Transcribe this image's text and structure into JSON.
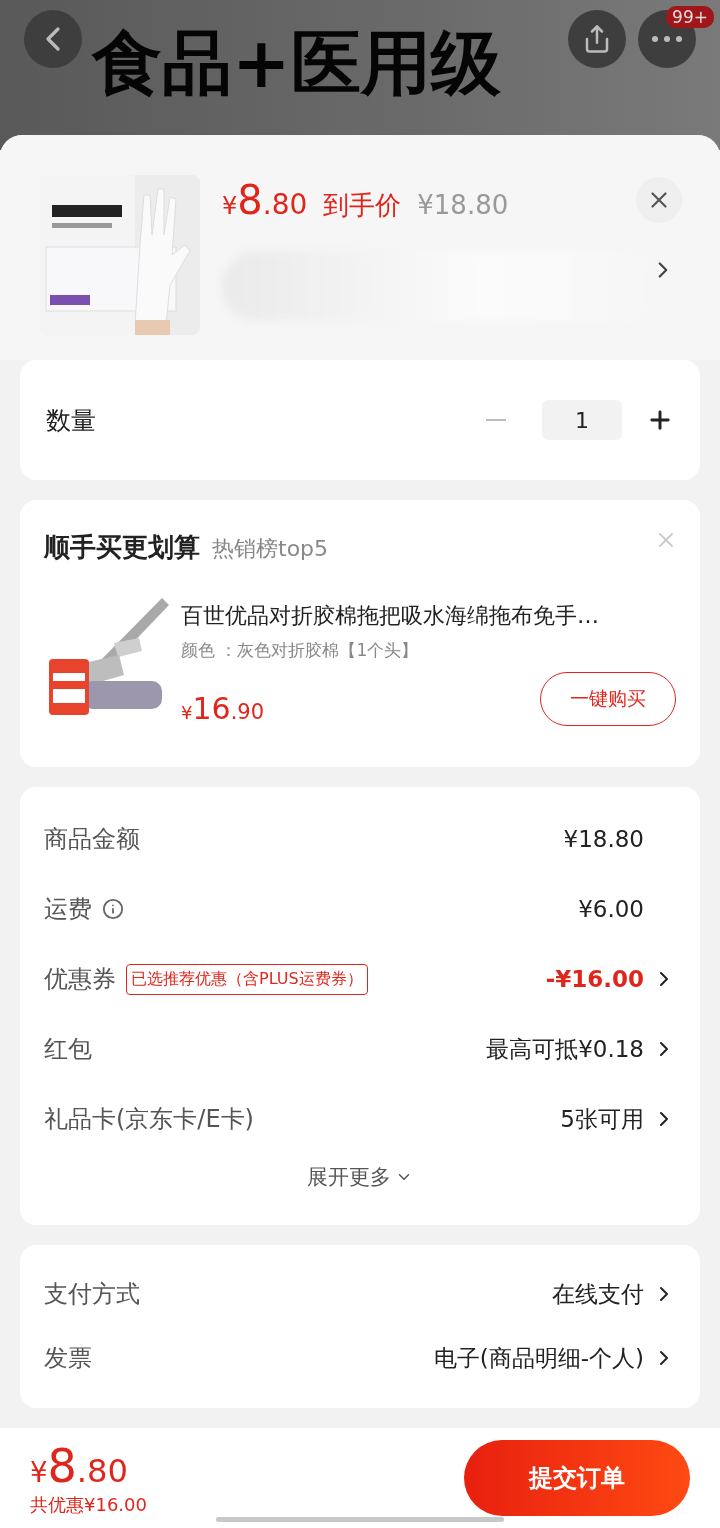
{
  "hero": {
    "title": "食品+医用级",
    "badge": "99+"
  },
  "header": {
    "price": {
      "currency": "¥",
      "integer": "8",
      "decimal": ".80"
    },
    "price_label": "到手价",
    "original_price": "¥18.80"
  },
  "quantity": {
    "label": "数量",
    "value": "1"
  },
  "recommend": {
    "title": "顺手买更划算",
    "subtitle": "热销榜top5",
    "item": {
      "name": "百世优品对折胶棉拖把吸水海绵拖布免手…",
      "spec": "颜色 ：灰色对折胶棉【1个头】",
      "price": {
        "currency": "¥",
        "integer": "16",
        "decimal": ".90"
      },
      "button": "一键购买"
    }
  },
  "summary": {
    "rows": [
      {
        "kind": "plain",
        "label": "商品金额",
        "value": "¥18.80",
        "info": false,
        "chevron": false
      },
      {
        "kind": "plain",
        "label": "运费",
        "value": "¥6.00",
        "info": true,
        "chevron": false
      },
      {
        "kind": "coupon",
        "label": "优惠券",
        "tag": "已选推荐优惠（含PLUS运费券）",
        "value": "-¥16.00",
        "info": false,
        "chevron": true
      },
      {
        "kind": "plain",
        "label": "红包",
        "value": "最高可抵¥0.18",
        "info": false,
        "chevron": true
      },
      {
        "kind": "plain",
        "label": "礼品卡(京东卡/E卡)",
        "value": "5张可用",
        "info": false,
        "chevron": true
      }
    ],
    "more": "展开更多"
  },
  "payment": {
    "rows": [
      {
        "label": "支付方式",
        "value": "在线支付"
      },
      {
        "label": "发票",
        "value": "电子(商品明细-个人)"
      }
    ]
  },
  "footer": {
    "price": {
      "currency": "¥",
      "integer": "8",
      "decimal": ".80"
    },
    "discount": "共优惠¥16.00",
    "submit": "提交订单"
  }
}
